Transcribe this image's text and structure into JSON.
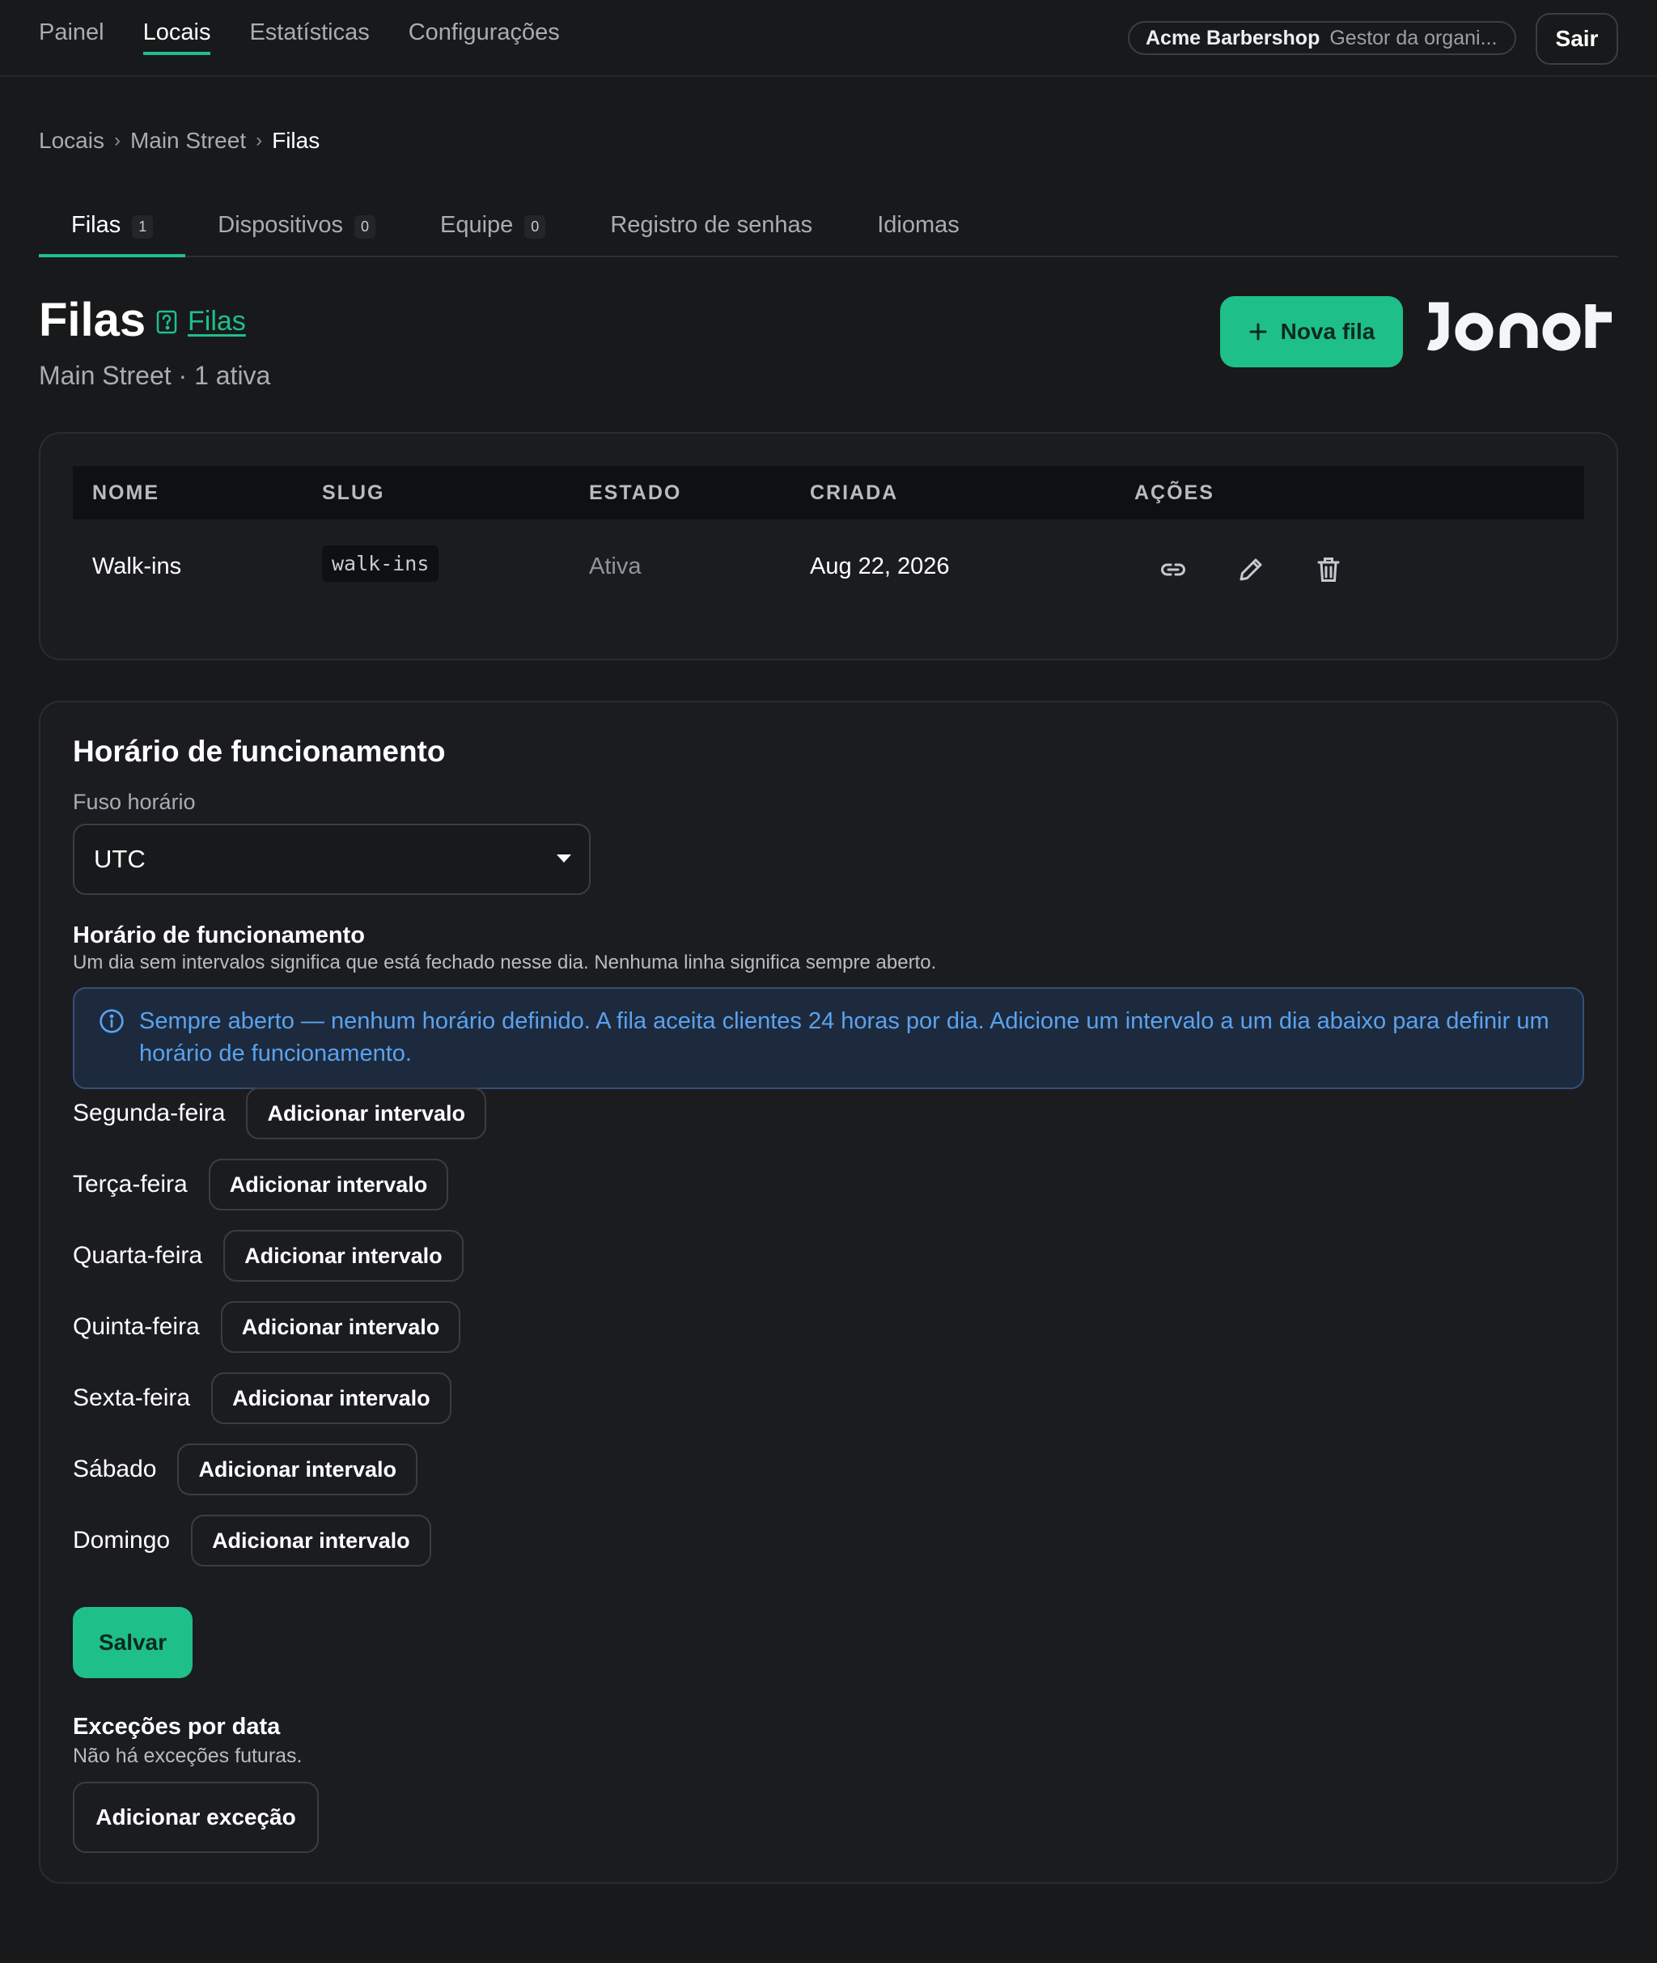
{
  "topnav": {
    "items": [
      {
        "label": "Painel"
      },
      {
        "label": "Locais"
      },
      {
        "label": "Estatísticas"
      },
      {
        "label": "Configurações"
      }
    ],
    "org_name": "Acme Barbershop",
    "org_role": "Gestor da organi...",
    "logout_label": "Sair"
  },
  "breadcrumb": [
    "Locais",
    "Main Street",
    "Filas"
  ],
  "tabs": [
    {
      "label": "Filas",
      "count": "1"
    },
    {
      "label": "Dispositivos",
      "count": "0"
    },
    {
      "label": "Equipe",
      "count": "0"
    },
    {
      "label": "Registro de senhas"
    },
    {
      "label": "Idiomas"
    }
  ],
  "header": {
    "title": "Filas",
    "help_link": "Filas",
    "subtitle": "Main Street · 1 ativa",
    "new_button": "Nova fila",
    "logo_text": "JONOT"
  },
  "table": {
    "columns": [
      "NOME",
      "SLUG",
      "ESTADO",
      "CRIADA",
      "AÇÕES"
    ],
    "rows": [
      {
        "name": "Walk-ins",
        "slug": "walk-ins",
        "status": "Ativa",
        "created": "Aug 22, 2026"
      }
    ]
  },
  "hours": {
    "title": "Horário de funcionamento",
    "timezone_label": "Fuso horário",
    "timezone_value": "UTC",
    "schedule_title": "Horário de funcionamento",
    "schedule_desc": "Um dia sem intervalos significa que está fechado nesse dia. Nenhuma linha significa sempre aberto.",
    "info_text": "Sempre aberto — nenhum horário definido. A fila aceita clientes 24 horas por dia. Adicione um intervalo a um dia abaixo para definir um horário de funcionamento.",
    "days": [
      {
        "name": "Segunda-feira",
        "button": "Adicionar intervalo"
      },
      {
        "name": "Terça-feira",
        "button": "Adicionar intervalo"
      },
      {
        "name": "Quarta-feira",
        "button": "Adicionar intervalo"
      },
      {
        "name": "Quinta-feira",
        "button": "Adicionar intervalo"
      },
      {
        "name": "Sexta-feira",
        "button": "Adicionar intervalo"
      },
      {
        "name": "Sábado",
        "button": "Adicionar intervalo"
      },
      {
        "name": "Domingo",
        "button": "Adicionar intervalo"
      }
    ],
    "save_label": "Salvar",
    "exceptions_title": "Exceções por data",
    "exceptions_desc": "Não há exceções futuras.",
    "exceptions_button": "Adicionar exceção"
  },
  "colors": {
    "accent": "#1fbf8a",
    "info": "#5aa2f0",
    "background": "#18191b"
  },
  "icons": [
    "help-doc-icon",
    "plus-icon",
    "link-icon",
    "pencil-icon",
    "trash-icon",
    "info-circle-icon",
    "chevron-down-icon"
  ]
}
